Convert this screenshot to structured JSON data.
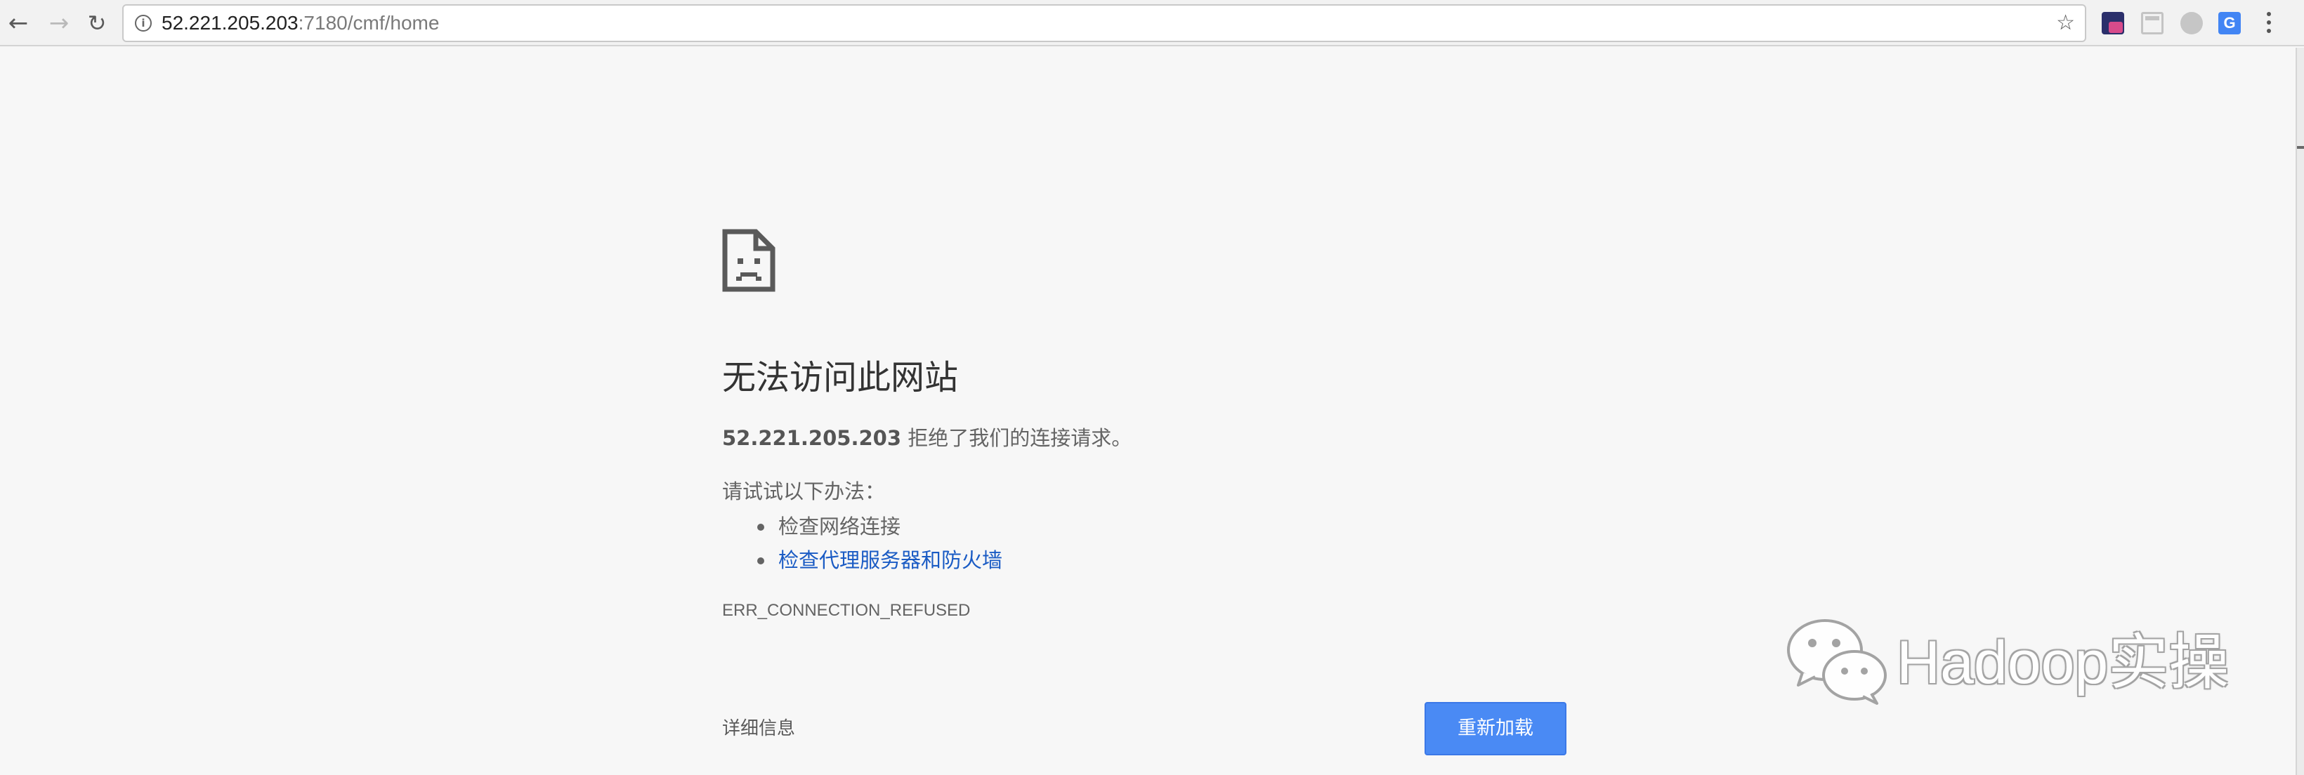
{
  "toolbar": {
    "back_glyph": "←",
    "forward_glyph": "→",
    "reload_glyph": "↻",
    "address": {
      "info_glyph": "i",
      "host": "52.221.205.203",
      "rest": ":7180/cmf/home",
      "star_glyph": "☆"
    },
    "extensions": [
      "extension-icon",
      "reader-icon",
      "chat-bubble-icon",
      "google-translate-icon"
    ],
    "menu_icon": "vertical-dots-icon"
  },
  "error_page": {
    "icon": "sad-document-icon",
    "title": "无法访问此网站",
    "summary": {
      "host": "52.221.205.203",
      "message": " 拒绝了我们的连接请求。"
    },
    "suggestions_heading": "请试试以下办法：",
    "suggestions": [
      {
        "label": "检查网络连接",
        "is_link": false
      },
      {
        "label": "检查代理服务器和防火墙",
        "is_link": true
      }
    ],
    "error_code": "ERR_CONNECTION_REFUSED",
    "details_label": "详细信息",
    "reload_label": "重新加载"
  },
  "watermark": {
    "logo": "wechat-logo-icon",
    "text": "Hadoop实操"
  },
  "colors": {
    "page_background": "#f7f7f7",
    "link": "#1a5bc4",
    "primary_button": "#4a8af4",
    "text_secondary": "#646464"
  }
}
